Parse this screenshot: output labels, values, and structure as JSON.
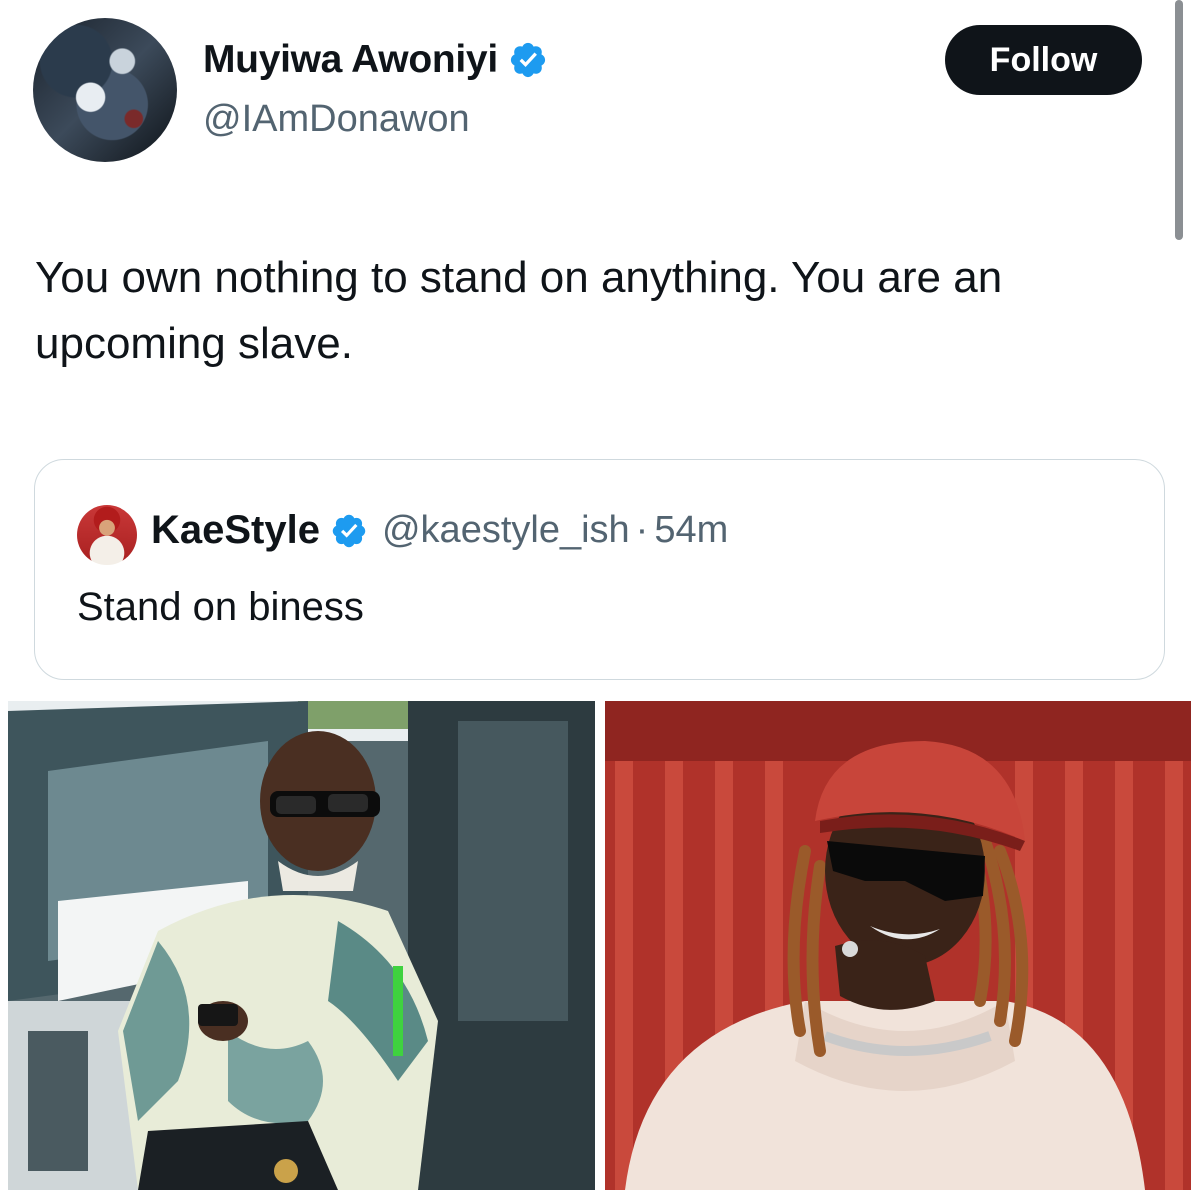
{
  "author": {
    "name": "Muyiwa Awoniyi",
    "handle": "@IAmDonawon",
    "verified": true,
    "avatar_icon": "profile-avatar"
  },
  "follow_label": "Follow",
  "tweet": {
    "text": "You own nothing to stand on anything. You are an upcoming slave."
  },
  "quote": {
    "name": "KaeStyle",
    "handle": "@kaestyle_ish",
    "separator": "·",
    "time": "54m",
    "text": "Stand on biness",
    "verified": true
  },
  "media": {
    "count": 2,
    "items": [
      "photo",
      "photo"
    ]
  },
  "colors": {
    "text_primary": "#0f1419",
    "text_secondary": "#536471",
    "verified_blue": "#1d9bf0",
    "border": "#cfd9de",
    "follow_bg": "#0f1419"
  }
}
